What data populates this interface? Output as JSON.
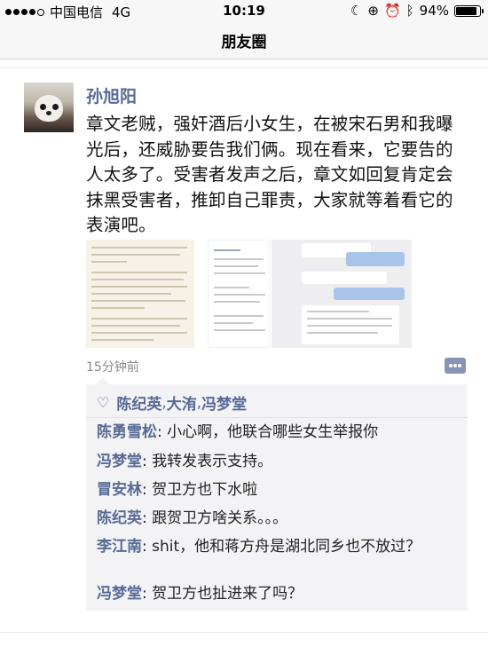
{
  "status_bar": {
    "carrier": "中国电信",
    "network": "4G",
    "time": "10:19",
    "battery": "94%",
    "battery_level": 0.94
  },
  "nav": {
    "title": "朋友圈"
  },
  "post": {
    "author": "孙旭阳",
    "text": "章文老贼，强奸酒后小女生，在被宋石男和我曝光后，还威胁要告我们俩。现在看来，它要告的人太多了。受害者发声之后，章文如回复肯定会抹黑受害者，推卸自己罪责，大家就等着看它的表演吧。",
    "timestamp": "15分钟前"
  },
  "likes": [
    "陈纪英",
    "大洧",
    "冯梦堂"
  ],
  "comments": [
    {
      "name": "陈勇雪松",
      "text": "小心啊，他联合哪些女生举报你"
    },
    {
      "name": "冯梦堂",
      "text": "我转发表示支持。"
    },
    {
      "name": "冒安林",
      "text": "贺卫方也下水啦"
    },
    {
      "name": "陈纪英",
      "text": "跟贺卫方啥关系。。。"
    },
    {
      "name": "李江南",
      "text": "shit，他和蒋方舟是湖北同乡也不放过？"
    },
    {
      "name": "冯梦堂",
      "text": "贺卫方也扯进来了吗？"
    }
  ],
  "colors": {
    "link": "#576b95",
    "comment_bg": "#f3f3f5"
  }
}
